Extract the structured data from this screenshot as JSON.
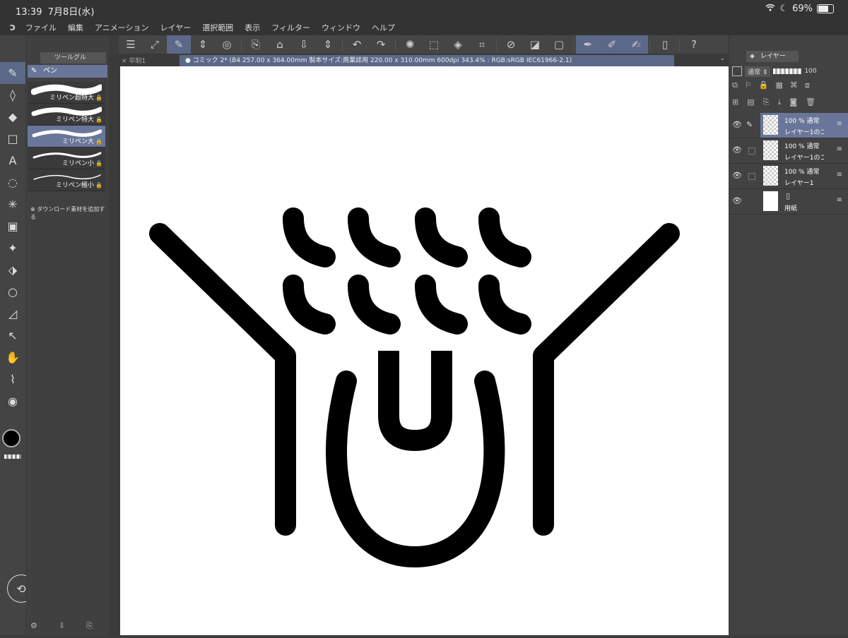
{
  "status": {
    "time": "13:39",
    "date": "7月8日(水)",
    "battery": "69%"
  },
  "menu": [
    "ファイル",
    "編集",
    "アニメーション",
    "レイヤー",
    "選択範囲",
    "表示",
    "フィルター",
    "ウィンドウ",
    "ヘルプ"
  ],
  "subtool": {
    "tab_label": "ツールグル",
    "group_label": "ペン",
    "brushes": [
      "ミリペン超特大",
      "ミリペン特大",
      "ミリペン大",
      "ミリペン小",
      "ミリペン極小"
    ],
    "selected_index": 2,
    "add_material": "ダウンロード素材を追加する"
  },
  "canvas_tabs": {
    "tab1": "卒制1",
    "tab2": "コミック 2* (B4 257.00 x 364.00mm 製本サイズ:商業誌用 220.00 x 310.00mm 600dpi 343.4% : RGB:sRGB IEC61966-2.1)"
  },
  "layers": {
    "tab_label": "レイヤー",
    "blend_mode": "通常",
    "opacity": "100",
    "items": [
      {
        "opacity": "100 %",
        "mode": "通常",
        "name": "レイヤー1のコピー",
        "selected": true
      },
      {
        "opacity": "100 %",
        "mode": "通常",
        "name": "レイヤー1のコピー",
        "selected": false
      },
      {
        "opacity": "100 %",
        "mode": "通常",
        "name": "レイヤー1",
        "selected": false
      },
      {
        "opacity": "",
        "mode": "",
        "name": "用紙",
        "selected": false
      }
    ]
  },
  "colors": {
    "accent": "#5c6888",
    "main_color": "#000000"
  }
}
